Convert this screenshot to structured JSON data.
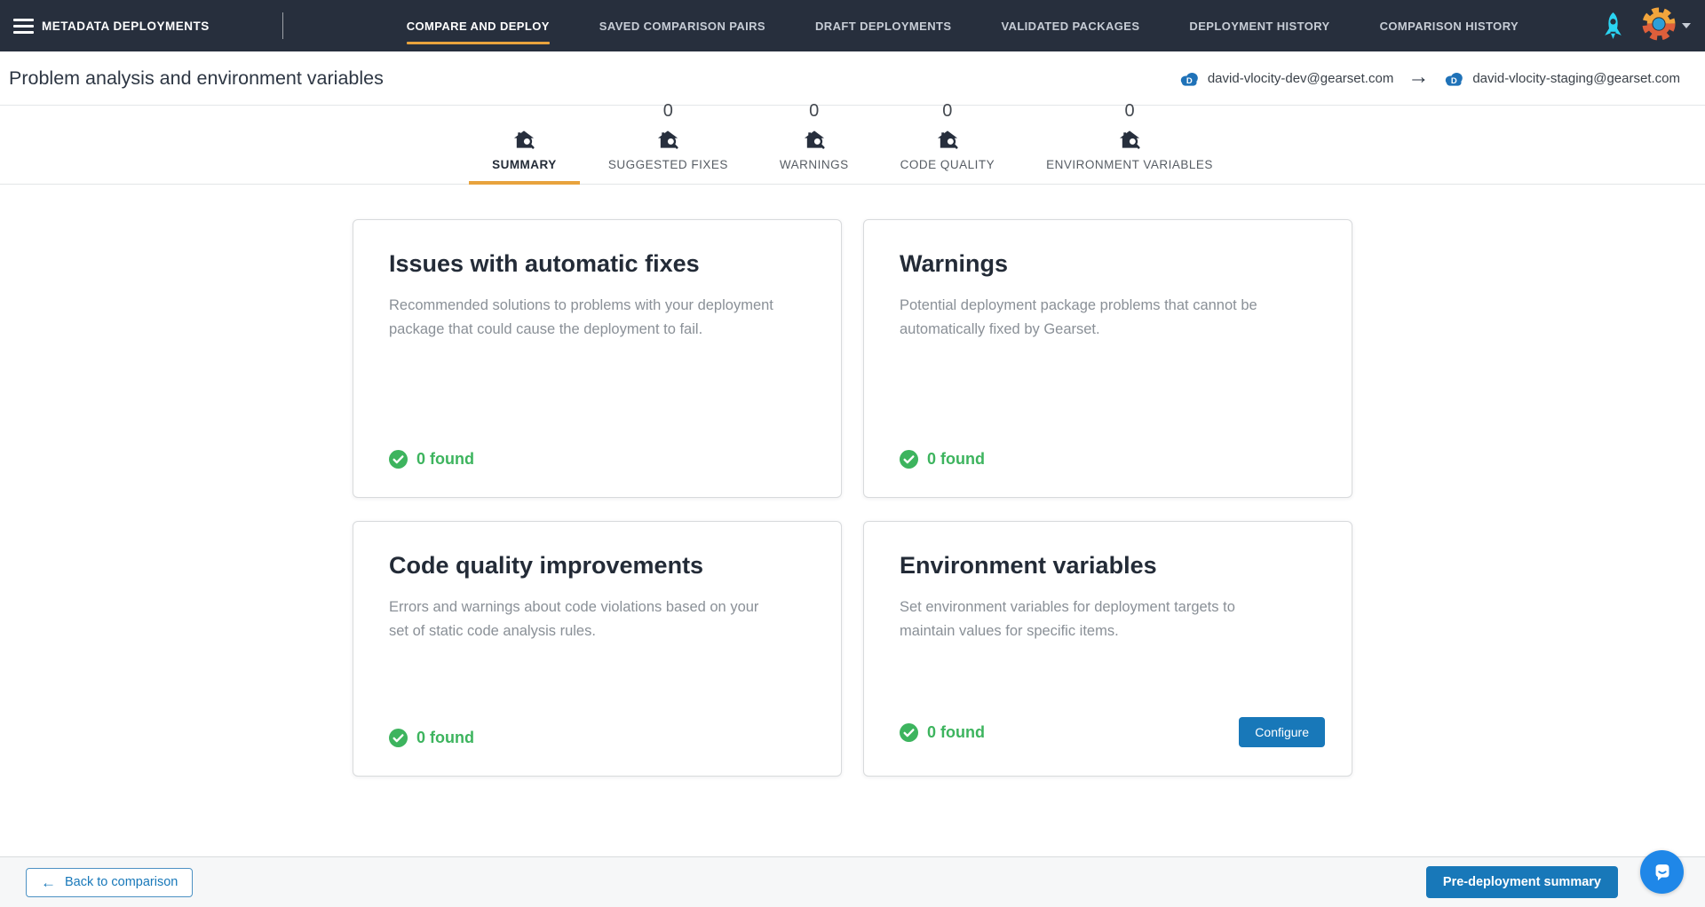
{
  "colors": {
    "nav_bg": "#272F3D",
    "accent_orange": "#E8A33D",
    "primary_blue": "#1878B9",
    "success_green": "#3DB45E",
    "rocket_cyan": "#2BD4F2",
    "org_cloud_blue": "#1F72B8",
    "chat_blue": "#1F87E8"
  },
  "nav": {
    "brand": "METADATA DEPLOYMENTS",
    "items": [
      {
        "label": "COMPARE AND DEPLOY",
        "active": true
      },
      {
        "label": "SAVED COMPARISON PAIRS",
        "active": false
      },
      {
        "label": "DRAFT DEPLOYMENTS",
        "active": false
      },
      {
        "label": "VALIDATED PACKAGES",
        "active": false
      },
      {
        "label": "DEPLOYMENT HISTORY",
        "active": false
      },
      {
        "label": "COMPARISON HISTORY",
        "active": false
      }
    ]
  },
  "header": {
    "title": "Problem analysis and environment variables",
    "source_org": {
      "label": "david-vlocity-dev@gearset.com",
      "badge_letter": "D"
    },
    "arrow": "→",
    "target_org": {
      "label": "david-vlocity-staging@gearset.com",
      "badge_letter": "D"
    }
  },
  "tabs": [
    {
      "label": "SUMMARY",
      "active": true,
      "icon": "home-search-icon"
    },
    {
      "label": "SUGGESTED FIXES",
      "count": "0",
      "active": false
    },
    {
      "label": "WARNINGS",
      "count": "0",
      "active": false
    },
    {
      "label": "CODE QUALITY",
      "count": "0",
      "active": false
    },
    {
      "label": "ENVIRONMENT VARIABLES",
      "count": "0",
      "active": false
    }
  ],
  "cards": [
    {
      "title": "Issues with automatic fixes",
      "description": "Recommended solutions to problems with your deployment package that could cause the deployment to fail.",
      "status": "0 found"
    },
    {
      "title": "Warnings",
      "description": "Potential deployment package problems that cannot be automatically fixed by Gearset.",
      "status": "0 found"
    },
    {
      "title": "Code quality improvements",
      "description": "Errors and warnings about code violations based on your set of static code analysis rules.",
      "status": "0 found"
    },
    {
      "title": "Environment variables",
      "description": "Set environment variables for deployment targets to maintain values for specific items.",
      "status": "0 found",
      "action": "Configure"
    }
  ],
  "footer": {
    "back_arrow": "←",
    "back_label": "Back to comparison",
    "primary_label": "Pre-deployment summary"
  }
}
